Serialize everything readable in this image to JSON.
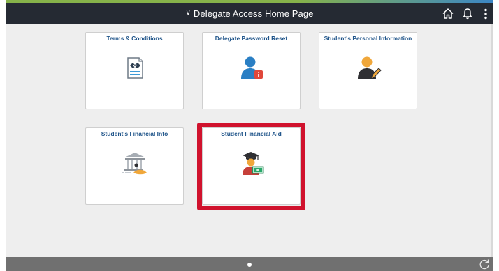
{
  "header": {
    "title": "Delegate Access Home Page",
    "title_menu_icon": "chevron-down-icon",
    "icons": [
      "home-icon",
      "notification-bell-icon",
      "actions-menu-icon"
    ],
    "background": "#252a33"
  },
  "tiles": [
    {
      "title": "Terms & Conditions",
      "icon": "document-handshake-icon"
    },
    {
      "title": "Delegate Password Reset",
      "icon": "user-info-icon"
    },
    {
      "title": "Student's Personal Information",
      "icon": "user-edit-icon"
    },
    {
      "title": "Student's Financial Info",
      "icon": "bank-payment-icon"
    },
    {
      "title": "Student Financial Aid",
      "icon": "graduate-money-icon",
      "highlighted": true
    }
  ],
  "footer": {
    "page_indicator": "page-dot-icon",
    "refresh_icon": "refresh-icon"
  },
  "colors": {
    "tile_title": "#20558a",
    "highlight": "#d0122d",
    "page_background": "#eeeeee"
  }
}
